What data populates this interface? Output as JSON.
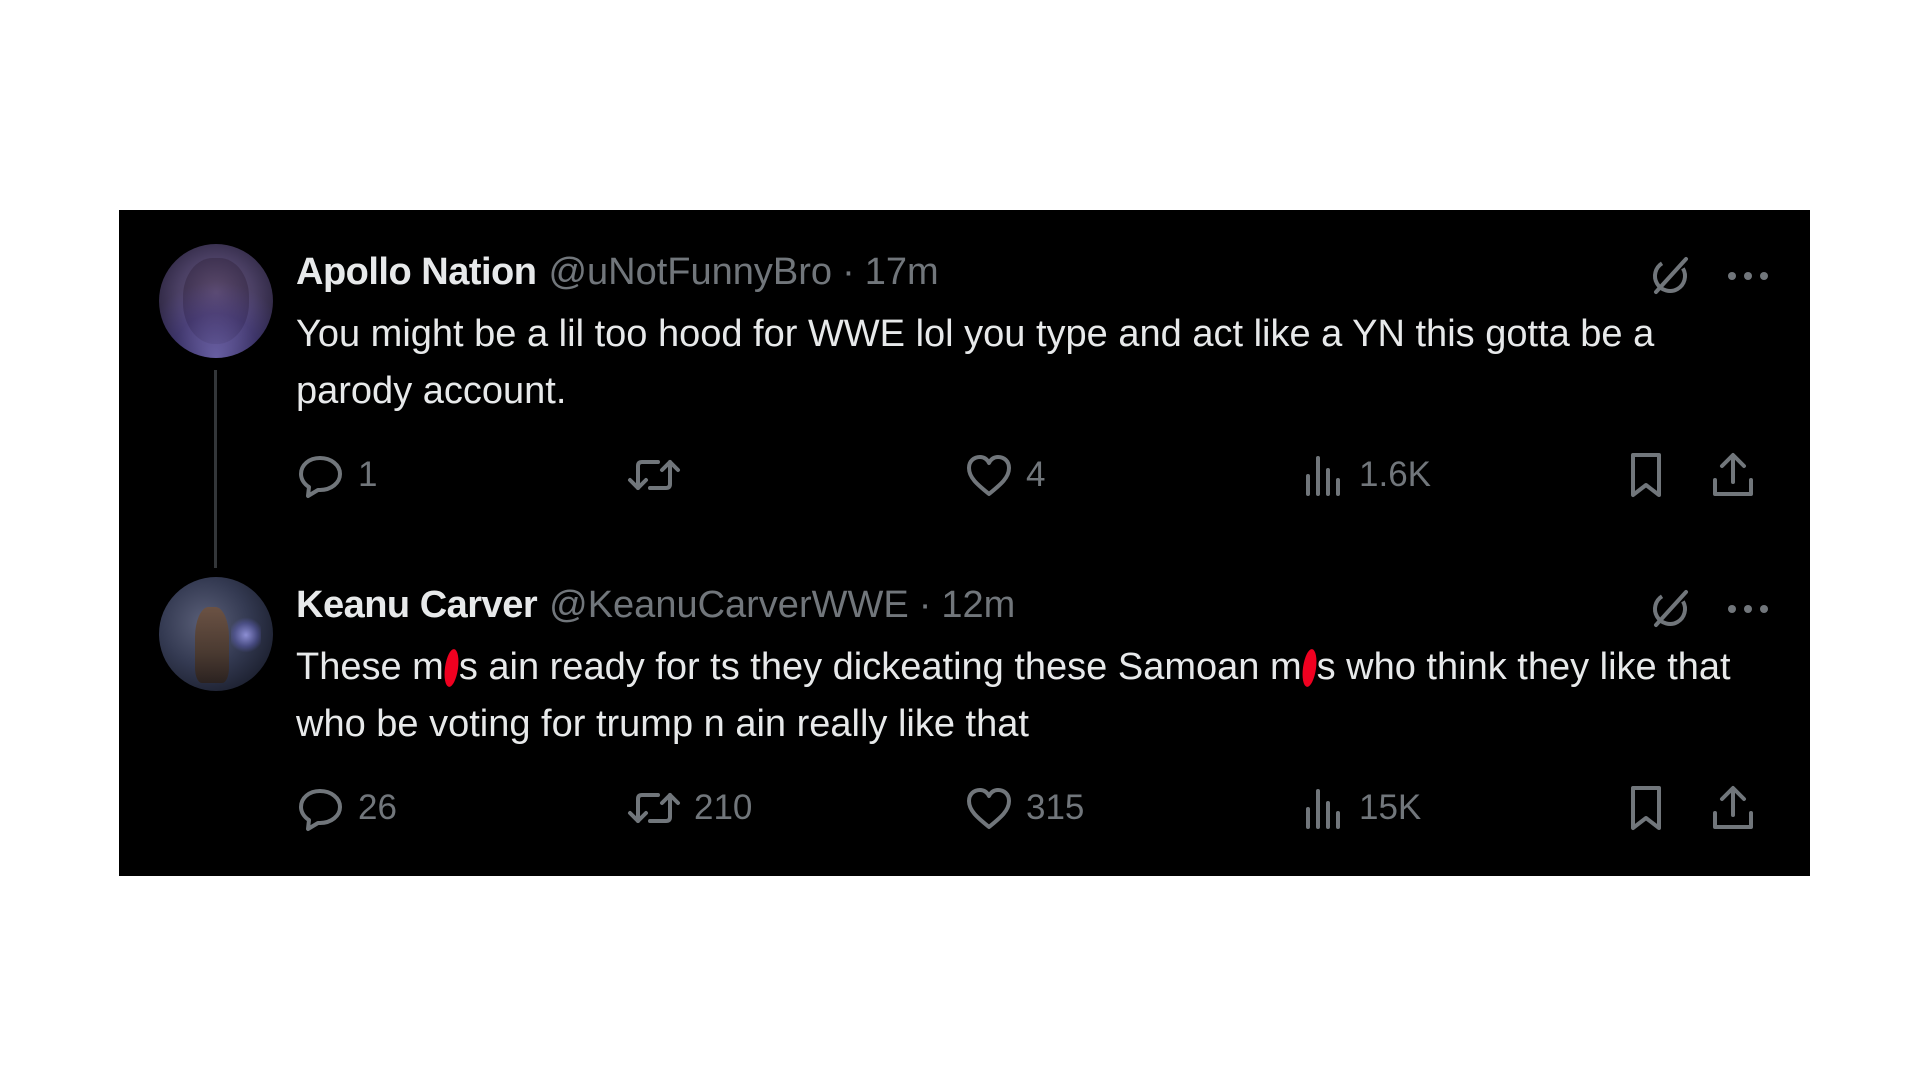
{
  "colors": {
    "background": "#000000",
    "primary_text": "#e7e9ea",
    "secondary_text": "#71767b",
    "thread_line": "#333639",
    "redaction": "#f00020"
  },
  "tweets": [
    {
      "display_name": "Apollo Nation",
      "handle": "@uNotFunnyBro",
      "separator": "·",
      "time": "17m",
      "avatar_icon": "user-avatar",
      "text_segments": [
        "You might be a lil too hood for WWE lol you type and act like a YN this gotta be a parody account."
      ],
      "replies": "1",
      "retweets": "",
      "likes": "4",
      "views": "1.6K"
    },
    {
      "display_name": "Keanu Carver",
      "handle": "@KeanuCarverWWE",
      "separator": "·",
      "time": "12m",
      "avatar_icon": "user-avatar",
      "text_segments": [
        "These m",
        "s ain ready for ts they dickeating these Samoan m",
        "s who think they like that who be voting for trump n ain really like that"
      ],
      "replies": "26",
      "retweets": "210",
      "likes": "315",
      "views": "15K"
    }
  ],
  "icons": {
    "grok": "grok-icon",
    "more": "more-icon",
    "reply": "reply-icon",
    "retweet": "retweet-icon",
    "like": "heart-icon",
    "views": "views-icon",
    "bookmark": "bookmark-icon",
    "share": "share-icon"
  }
}
